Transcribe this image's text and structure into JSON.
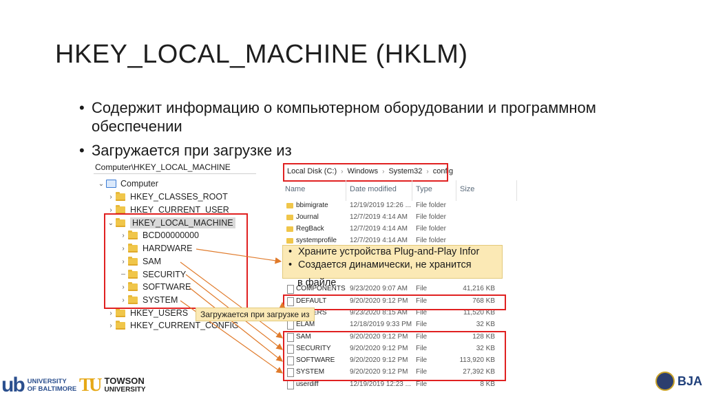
{
  "slide": {
    "title": "HKEY_LOCAL_MACHINE (HKLM)",
    "bullets": [
      "Содержит информацию о компьютерном оборудовании и программном обеспечении",
      "Загружается при загрузке из"
    ]
  },
  "registry": {
    "path": "Computer\\HKEY_LOCAL_MACHINE",
    "tree": [
      {
        "label": "Computer",
        "expanded": true
      },
      {
        "label": "HKEY_CLASSES_ROOT"
      },
      {
        "label": "HKEY_CURRENT_USER"
      },
      {
        "label": "HKEY_LOCAL_MACHINE",
        "expanded": true,
        "selected": true
      },
      {
        "label": "BCD00000000"
      },
      {
        "label": "HARDWARE"
      },
      {
        "label": "SAM"
      },
      {
        "label": "SECURITY"
      },
      {
        "label": "SOFTWARE"
      },
      {
        "label": "SYSTEM"
      },
      {
        "label": "HKEY_USERS"
      },
      {
        "label": "HKEY_CURRENT_CONFIG"
      }
    ]
  },
  "explorer": {
    "breadcrumb": [
      "Local Disk (C:)",
      "Windows",
      "System32",
      "config"
    ],
    "columns": {
      "name": "Name",
      "date": "Date modified",
      "type": "Type",
      "size": "Size"
    },
    "files": [
      {
        "name": "bbimigrate",
        "date": "12/19/2019 12:26 ...",
        "type": "File folder",
        "size": ""
      },
      {
        "name": "Journal",
        "date": "12/7/2019 4:14 AM",
        "type": "File folder",
        "size": ""
      },
      {
        "name": "RegBack",
        "date": "12/7/2019 4:14 AM",
        "type": "File folder",
        "size": ""
      },
      {
        "name": "systemprofile",
        "date": "12/7/2019 4:14 AM",
        "type": "File folder",
        "size": ""
      },
      {
        "name": "COMPONENTS",
        "date": "9/23/2020 9:07 AM",
        "type": "File",
        "size": "41,216 KB"
      },
      {
        "name": "DEFAULT",
        "date": "9/20/2020 9:12 PM",
        "type": "File",
        "size": "768 KB"
      },
      {
        "name": "DRIVERS",
        "date": "9/23/2020 8:15 AM",
        "type": "File",
        "size": "11,520 KB"
      },
      {
        "name": "ELAM",
        "date": "12/18/2019 9:33 PM",
        "type": "File",
        "size": "32 KB"
      },
      {
        "name": "SAM",
        "date": "9/20/2020 9:12 PM",
        "type": "File",
        "size": "128 KB"
      },
      {
        "name": "SECURITY",
        "date": "9/20/2020 9:12 PM",
        "type": "File",
        "size": "32 KB"
      },
      {
        "name": "SOFTWARE",
        "date": "9/20/2020 9:12 PM",
        "type": "File",
        "size": "113,920 KB"
      },
      {
        "name": "SYSTEM",
        "date": "9/20/2020 9:12 PM",
        "type": "File",
        "size": "27,392 KB"
      },
      {
        "name": "userdiff",
        "date": "12/19/2019 12:23 ...",
        "type": "File",
        "size": "8 KB"
      }
    ]
  },
  "tooltips": {
    "hardware": [
      "Храните устройства Plug-and-Play Infor",
      "Создается динамически, не хранится"
    ],
    "hardware_overflow": "в файле",
    "boot": "Загружается при загрузке из"
  },
  "logos": {
    "ub_mark": "ub",
    "ub_line1": "UNIVERSITY",
    "ub_line2": "OF BALTIMORE",
    "tu_mark": "TU",
    "tu_line1": "TOWSON",
    "tu_line2": "UNIVERSITY",
    "bja": "BJA"
  },
  "colors": {
    "highlight_box": "#e02020",
    "tooltip_bg": "#fbe9b5",
    "arrow": "#e07a2a",
    "folder": "#f0c64a"
  }
}
